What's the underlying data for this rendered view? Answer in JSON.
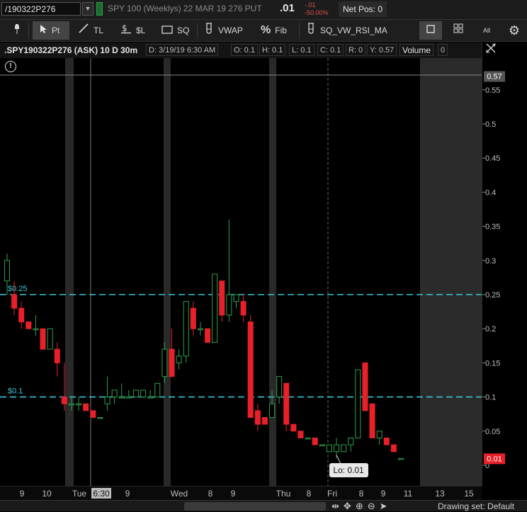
{
  "header": {
    "symbol_value": "/190322P276",
    "description": "SPY 100 (Weeklys) 22 MAR 19 276 PUT",
    "last_price": ".01",
    "change_net": "-.01",
    "change_pct": "-50.00%",
    "net_pos": "Net Pos: 0"
  },
  "toolbar": {
    "pin_label": "",
    "pointer_label": "Pt",
    "trendline_label": "TL",
    "price_level_label": "$L",
    "square_label": "SQ",
    "vwap_label": "VWAP",
    "fib_label": "Fib",
    "study_label": "SQ_VW_RSI_MA",
    "all_label": "All"
  },
  "info": {
    "title": ".SPY190322P276 (ASK) 10 D 30m",
    "date": "D: 3/19/19 6:30 AM",
    "open": "O: 0.1",
    "high": "H: 0.1",
    "low": "L: 0.1",
    "close": "C: 0.1",
    "range": "R: 0",
    "y": "Y: 0.57",
    "volume_label": "Volume",
    "volume_value": "0"
  },
  "chart_data": {
    "type": "candlestick",
    "y_axis": {
      "min": 0,
      "max": 0.57,
      "ticks": [
        0,
        0.05,
        0.1,
        0.15,
        0.2,
        0.25,
        0.3,
        0.35,
        0.4,
        0.45,
        0.5,
        0.55
      ],
      "tick_labels": [
        "0",
        "0.05",
        "0.1",
        "0.15",
        "0.2",
        "0.25",
        "0.3",
        "0.35",
        "0.4",
        "0.45",
        "0.5",
        "0.55"
      ]
    },
    "x_labels": [
      "9",
      "10",
      "Tue",
      "6:30",
      "9",
      "Wed",
      "8",
      "9",
      "Thu",
      "8",
      "Fri",
      "8",
      "9",
      "11",
      "13",
      "15"
    ],
    "price_levels": [
      {
        "label": "$0.25",
        "value": 0.25,
        "color": "#39c6d6"
      },
      {
        "label": "$0.1",
        "value": 0.1,
        "color": "#39c6d6"
      }
    ],
    "cursor_price_label": "0.57",
    "last_price_label": "0.01",
    "low_bubble": "Lo: 0.01",
    "candles": [
      {
        "o": 0.27,
        "h": 0.31,
        "l": 0.25,
        "c": 0.3
      },
      {
        "o": 0.25,
        "h": 0.27,
        "l": 0.22,
        "c": 0.23
      },
      {
        "o": 0.23,
        "h": 0.24,
        "l": 0.2,
        "c": 0.21
      },
      {
        "o": 0.21,
        "h": 0.21,
        "l": 0.2,
        "c": 0.2
      },
      {
        "o": 0.2,
        "h": 0.22,
        "l": 0.19,
        "c": 0.2
      },
      {
        "o": 0.2,
        "h": 0.2,
        "l": 0.17,
        "c": 0.17
      },
      {
        "o": 0.17,
        "h": 0.2,
        "l": 0.17,
        "c": 0.2
      },
      {
        "o": 0.17,
        "h": 0.18,
        "l": 0.13,
        "c": 0.15
      },
      {
        "o": 0.1,
        "h": 0.15,
        "l": 0.08,
        "c": 0.09
      },
      {
        "o": 0.09,
        "h": 0.1,
        "l": 0.08,
        "c": 0.09
      },
      {
        "o": 0.09,
        "h": 0.1,
        "l": 0.08,
        "c": 0.09
      },
      {
        "o": 0.09,
        "h": 0.09,
        "l": 0.08,
        "c": 0.08
      },
      {
        "o": 0.08,
        "h": 0.08,
        "l": 0.07,
        "c": 0.07
      },
      {
        "o": 0.07,
        "h": 0.07,
        "l": 0.07,
        "c": 0.07
      },
      {
        "o": 0.09,
        "h": 0.13,
        "l": 0.08,
        "c": 0.1
      },
      {
        "o": 0.1,
        "h": 0.11,
        "l": 0.09,
        "c": 0.11
      },
      {
        "o": 0.1,
        "h": 0.12,
        "l": 0.1,
        "c": 0.1
      },
      {
        "o": 0.1,
        "h": 0.11,
        "l": 0.1,
        "c": 0.1
      },
      {
        "o": 0.1,
        "h": 0.11,
        "l": 0.1,
        "c": 0.11
      },
      {
        "o": 0.1,
        "h": 0.11,
        "l": 0.1,
        "c": 0.11
      },
      {
        "o": 0.1,
        "h": 0.11,
        "l": 0.1,
        "c": 0.1
      },
      {
        "o": 0.1,
        "h": 0.12,
        "l": 0.1,
        "c": 0.12
      },
      {
        "o": 0.13,
        "h": 0.18,
        "l": 0.12,
        "c": 0.17
      },
      {
        "o": 0.17,
        "h": 0.2,
        "l": 0.13,
        "c": 0.13
      },
      {
        "o": 0.15,
        "h": 0.17,
        "l": 0.14,
        "c": 0.16
      },
      {
        "o": 0.16,
        "h": 0.24,
        "l": 0.15,
        "c": 0.24
      },
      {
        "o": 0.23,
        "h": 0.24,
        "l": 0.19,
        "c": 0.2
      },
      {
        "o": 0.2,
        "h": 0.21,
        "l": 0.19,
        "c": 0.2
      },
      {
        "o": 0.2,
        "h": 0.2,
        "l": 0.18,
        "c": 0.18
      },
      {
        "o": 0.18,
        "h": 0.28,
        "l": 0.18,
        "c": 0.28
      },
      {
        "o": 0.27,
        "h": 0.27,
        "l": 0.21,
        "c": 0.22
      },
      {
        "o": 0.22,
        "h": 0.36,
        "l": 0.21,
        "c": 0.25
      },
      {
        "o": 0.24,
        "h": 0.25,
        "l": 0.23,
        "c": 0.25
      },
      {
        "o": 0.24,
        "h": 0.25,
        "l": 0.21,
        "c": 0.22
      },
      {
        "o": 0.21,
        "h": 0.22,
        "l": 0.07,
        "c": 0.07
      },
      {
        "o": 0.08,
        "h": 0.09,
        "l": 0.05,
        "c": 0.06
      },
      {
        "o": 0.07,
        "h": 0.07,
        "l": 0.06,
        "c": 0.06
      },
      {
        "o": 0.07,
        "h": 0.11,
        "l": 0.07,
        "c": 0.09
      },
      {
        "o": 0.1,
        "h": 0.13,
        "l": 0.09,
        "c": 0.13
      },
      {
        "o": 0.12,
        "h": 0.12,
        "l": 0.05,
        "c": 0.06
      },
      {
        "o": 0.06,
        "h": 0.06,
        "l": 0.05,
        "c": 0.05
      },
      {
        "o": 0.05,
        "h": 0.05,
        "l": 0.04,
        "c": 0.04
      },
      {
        "o": 0.04,
        "h": 0.04,
        "l": 0.04,
        "c": 0.04
      },
      {
        "o": 0.04,
        "h": 0.04,
        "l": 0.03,
        "c": 0.03
      },
      {
        "o": 0.03,
        "h": 0.03,
        "l": 0.03,
        "c": 0.03
      },
      {
        "o": 0.02,
        "h": 0.03,
        "l": 0.02,
        "c": 0.03
      },
      {
        "o": 0.02,
        "h": 0.04,
        "l": 0.01,
        "c": 0.03
      },
      {
        "o": 0.02,
        "h": 0.03,
        "l": 0.02,
        "c": 0.03
      },
      {
        "o": 0.03,
        "h": 0.04,
        "l": 0.02,
        "c": 0.04
      },
      {
        "o": 0.04,
        "h": 0.14,
        "l": 0.04,
        "c": 0.14
      },
      {
        "o": 0.15,
        "h": 0.15,
        "l": 0.08,
        "c": 0.08
      },
      {
        "o": 0.09,
        "h": 0.09,
        "l": 0.04,
        "c": 0.04
      },
      {
        "o": 0.04,
        "h": 0.05,
        "l": 0.03,
        "c": 0.05
      },
      {
        "o": 0.04,
        "h": 0.04,
        "l": 0.03,
        "c": 0.03
      },
      {
        "o": 0.03,
        "h": 0.03,
        "l": 0.02,
        "c": 0.02
      },
      {
        "o": 0.01,
        "h": 0.01,
        "l": 0.01,
        "c": 0.01
      }
    ]
  },
  "status": {
    "drawing_set": "Drawing set: Default"
  },
  "colors": {
    "up": "#2fa04a",
    "down": "#e8202a",
    "level": "#39c6d6",
    "session_sep": "#4a4a4a",
    "expansion_area": "#2b2b2b"
  }
}
